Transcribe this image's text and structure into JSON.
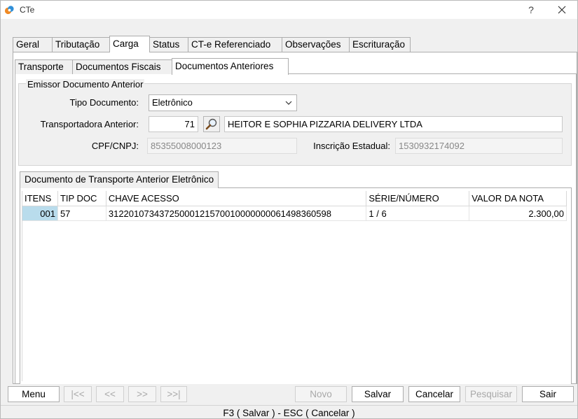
{
  "window": {
    "title": "CTe",
    "help": "?"
  },
  "main_tabs": [
    "Geral",
    "Tributação",
    "Carga",
    "Status",
    "CT-e Referenciado",
    "Observações",
    "Escrituração"
  ],
  "sub_tabs": [
    "Transporte",
    "Documentos Fiscais",
    "Documentos Anteriores"
  ],
  "emissor": {
    "legend": "Emissor Documento Anterior",
    "tipo_label": "Tipo Documento:",
    "tipo_value": "Eletrônico",
    "transportadora_label": "Transportadora Anterior:",
    "transportadora_code": "71",
    "transportadora_name": "HEITOR E SOPHIA PIZZARIA DELIVERY LTDA",
    "cpf_label": "CPF/CNPJ:",
    "cpf_value": "85355008000123",
    "ie_label": "Inscrição Estadual:",
    "ie_value": "1530932174092"
  },
  "grid": {
    "tab_label": "Documento de Transporte Anterior Eletrônico",
    "columns": [
      "ITENS",
      "TIP DOC",
      "CHAVE ACESSO",
      "SÉRIE/NÚMERO",
      "VALOR DA NOTA"
    ],
    "rows": [
      [
        "001",
        "57",
        "31220107343725000121570010000000061498360598",
        "1 / 6",
        "2.300,00"
      ]
    ]
  },
  "toolbar": {
    "menu": "Menu",
    "first": "|<<",
    "prev": "<<",
    "next": ">>",
    "last": ">>|",
    "novo": "Novo",
    "salvar": "Salvar",
    "cancelar": "Cancelar",
    "pesquisar": "Pesquisar",
    "sair": "Sair"
  },
  "status": "F3 ( Salvar )  -  ESC ( Cancelar )"
}
